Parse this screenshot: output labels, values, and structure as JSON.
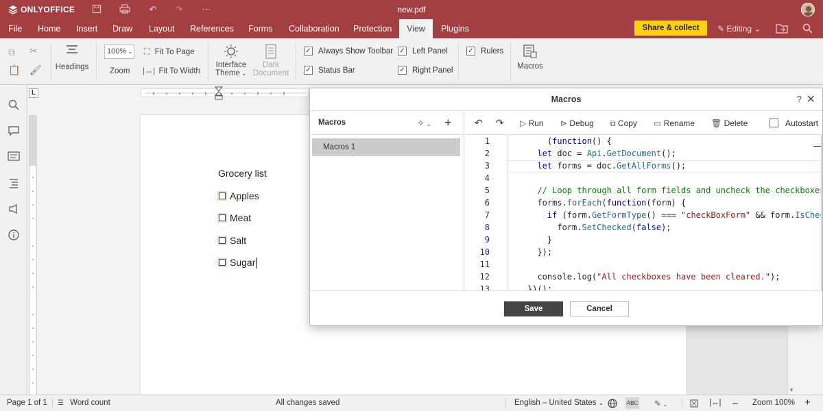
{
  "app": {
    "brand": "ONLYOFFICE",
    "doc_title": "new.pdf"
  },
  "menu": {
    "tabs": [
      "File",
      "Home",
      "Insert",
      "Draw",
      "Layout",
      "References",
      "Forms",
      "Collaboration",
      "Protection",
      "View",
      "Plugins"
    ],
    "active_tab": "View",
    "share_label": "Share & collect",
    "editing_label": "Editing"
  },
  "ribbon": {
    "headings_label": "Headings",
    "zoom_value": "100%",
    "zoom_label": "Zoom",
    "fit_page": "Fit To Page",
    "fit_width": "Fit To Width",
    "interface_theme_1": "Interface",
    "interface_theme_2": "Theme",
    "dark_doc_1": "Dark",
    "dark_doc_2": "Document",
    "always_show_toolbar": "Always Show Toolbar",
    "status_bar": "Status Bar",
    "left_panel": "Left Panel",
    "right_panel": "Right Panel",
    "rulers": "Rulers",
    "macros": "Macros"
  },
  "document": {
    "heading": "Grocery list",
    "items": [
      "Apples",
      "Meat",
      "Salt",
      "Sugar"
    ]
  },
  "dialog": {
    "title": "Macros",
    "help": "?",
    "list_title": "Macros",
    "macro_item": "Macros 1",
    "run": "Run",
    "debug": "Debug",
    "copy": "Copy",
    "rename": "Rename",
    "delete": "Delete",
    "autostart": "Autostart",
    "save": "Save",
    "cancel": "Cancel",
    "line_numbers": [
      "1",
      "2",
      "3",
      "4",
      "5",
      "6",
      "7",
      "8",
      "9",
      "10",
      "11",
      "12",
      "13"
    ]
  },
  "status": {
    "page": "Page 1 of 1",
    "word_count": "Word count",
    "saved": "All changes saved",
    "language": "English – United States",
    "zoom": "Zoom 100%"
  },
  "colors": {
    "brand": "#a33f42",
    "share": "#ffd112"
  }
}
